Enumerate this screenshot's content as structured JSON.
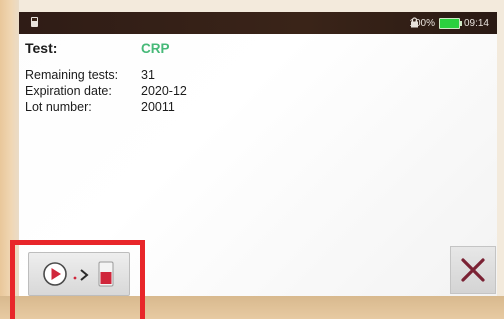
{
  "status_bar": {
    "battery_level": "100%",
    "time": "09:14",
    "battery_color": "#2bd13f"
  },
  "test": {
    "label": "Test:",
    "value": "CRP",
    "value_color": "#46b978"
  },
  "details": {
    "remaining_label": "Remaining tests:",
    "remaining_value": "31",
    "expiration_label": "Expiration date:",
    "expiration_value": "2020-12",
    "lot_label": "Lot number:",
    "lot_value": "20011"
  },
  "actions": {
    "start_icons": [
      "play-circle-icon",
      "arrow-right-icon",
      "cartridge-icon"
    ],
    "close_icon": "close-icon"
  },
  "highlight_color": "#e8262a"
}
